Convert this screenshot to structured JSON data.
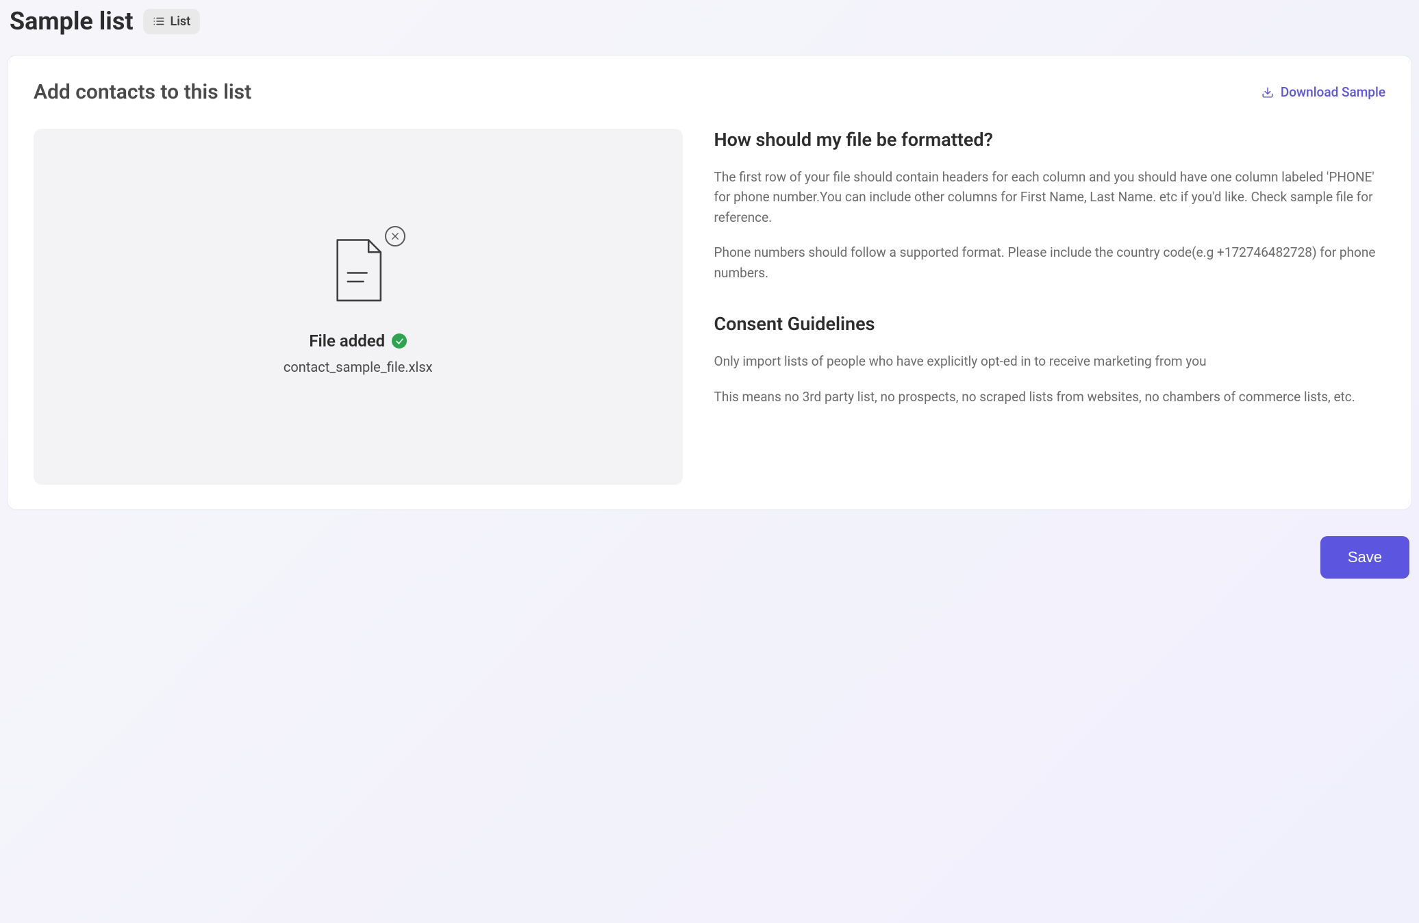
{
  "header": {
    "title": "Sample list",
    "badge_label": "List"
  },
  "card": {
    "title": "Add contacts to this list",
    "download_label": "Download Sample"
  },
  "upload": {
    "status_label": "File added",
    "file_name": "contact_sample_file.xlsx"
  },
  "format": {
    "heading": "How should my file be formatted?",
    "p1": "The first row of your file should contain headers for each column and you should have one column labeled 'PHONE' for phone number.You can include other columns for First Name, Last Name. etc if you'd like. Check sample file for reference.",
    "p2": "Phone numbers should follow a supported format. Please include the country code(e.g +172746482728) for phone numbers."
  },
  "consent": {
    "heading": "Consent Guidelines",
    "p1": "Only import lists of people who have explicitly opt-ed in to receive marketing from you",
    "p2": "This means no 3rd party list, no prospects, no scraped lists from websites, no chambers of commerce lists, etc."
  },
  "actions": {
    "save_label": "Save"
  }
}
